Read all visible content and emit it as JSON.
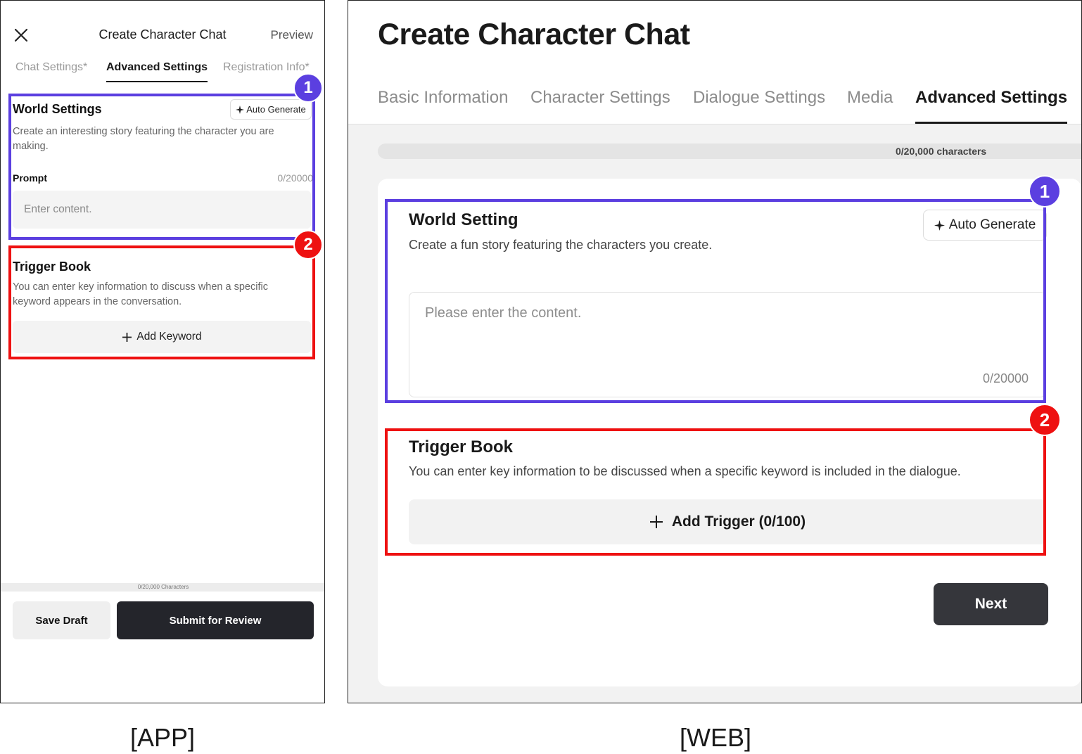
{
  "app": {
    "title": "Create Character Chat",
    "preview": "Preview",
    "tabs": [
      {
        "label": "Chat Settings*",
        "active": false
      },
      {
        "label": "Advanced Settings",
        "active": true
      },
      {
        "label": "Registration Info*",
        "active": false
      }
    ],
    "world": {
      "title": "World Settings",
      "auto_generate": "Auto Generate",
      "description": "Create an interesting story featuring the character you are making.",
      "prompt_label": "Prompt",
      "prompt_count": "0/20000",
      "prompt_placeholder": "Enter content."
    },
    "trigger": {
      "title": "Trigger Book",
      "description": "You can enter key information to discuss when a specific keyword appears in the conversation.",
      "add_keyword": "Add Keyword"
    },
    "progress_text": "0/20,000 Characters",
    "progress_fraction": 0,
    "save_draft": "Save Draft",
    "submit": "Submit for Review",
    "badges": {
      "one": "1",
      "two": "2"
    }
  },
  "web": {
    "title": "Create Character Chat",
    "tabs": [
      {
        "label": "Basic Information",
        "active": false
      },
      {
        "label": "Character Settings",
        "active": false
      },
      {
        "label": "Dialogue Settings",
        "active": false
      },
      {
        "label": "Media",
        "active": false
      },
      {
        "label": "Advanced Settings",
        "active": true
      }
    ],
    "progress_text": "0/20,000 characters",
    "progress_fraction": 0,
    "world": {
      "title": "World Setting",
      "description": "Create a fun story featuring the characters you create.",
      "auto_generate": "Auto Generate",
      "placeholder": "Please enter the content.",
      "count": "0/20000"
    },
    "trigger": {
      "title": "Trigger Book",
      "description": "You can enter key information to be discussed when a specific keyword is included in the dialogue.",
      "add_trigger": "Add Trigger (0/100)"
    },
    "next": "Next",
    "badges": {
      "one": "1",
      "two": "2"
    }
  },
  "captions": {
    "app": "[APP]",
    "web": "[WEB]"
  },
  "colors": {
    "annotation_purple": "#5b3fe0",
    "annotation_red": "#ee1111",
    "primary_button": "#24252b"
  },
  "icons": {
    "close": "close-icon",
    "sparkle": "sparkle-icon",
    "plus": "plus-icon"
  }
}
